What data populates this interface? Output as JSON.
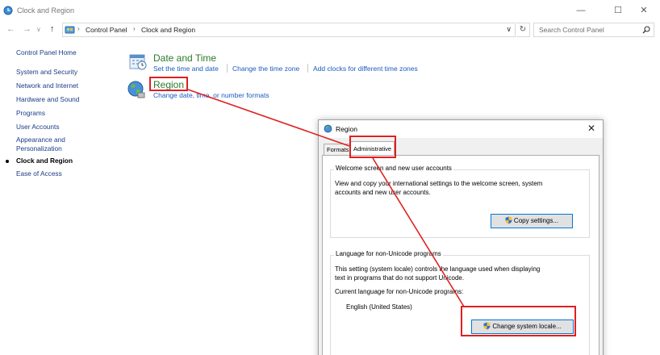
{
  "window": {
    "title": "Clock and Region",
    "controls": {
      "minimize": "—",
      "maximize": "☐",
      "close": "✕"
    }
  },
  "nav": {
    "back": "←",
    "forward": "→",
    "up": "↑",
    "dropdown": "∨",
    "refresh": "↻"
  },
  "address": {
    "segments": [
      "Control Panel",
      "Clock and Region"
    ],
    "chevron": "›"
  },
  "search": {
    "placeholder": "Search Control Panel"
  },
  "sidebar": {
    "home": "Control Panel Home",
    "items": [
      {
        "label": "System and Security"
      },
      {
        "label": "Network and Internet"
      },
      {
        "label": "Hardware and Sound"
      },
      {
        "label": "Programs"
      },
      {
        "label": "User Accounts"
      },
      {
        "label": "Appearance and Personalization"
      },
      {
        "label": "Clock and Region",
        "current": true
      },
      {
        "label": "Ease of Access"
      }
    ]
  },
  "main": {
    "date_time": {
      "title": "Date and Time",
      "links": [
        "Set the time and date",
        "Change the time zone",
        "Add clocks for different time zones"
      ]
    },
    "region": {
      "title": "Region",
      "links": [
        "Change date, time, or number formats"
      ]
    }
  },
  "dialog": {
    "title": "Region",
    "close": "✕",
    "tabs": [
      "Formats",
      "Administrative"
    ],
    "active_tab": "Administrative",
    "welcome": {
      "label": "Welcome screen and new user accounts",
      "text_line1": "View and copy your international settings to the welcome screen, system",
      "text_line2": "accounts and new user accounts.",
      "button": "Copy settings..."
    },
    "unicode": {
      "label": "Language for non-Unicode programs",
      "text_line1": "This setting (system locale) controls the language used when displaying",
      "text_line2": "text in programs that do not support Unicode.",
      "current_label": "Current language for non-Unicode programs:",
      "current_value": "English (United States)",
      "button": "Change system locale..."
    }
  },
  "colors": {
    "highlight": "#e02020",
    "link": "#1b5bbf",
    "section_title": "#2b7a2b"
  }
}
